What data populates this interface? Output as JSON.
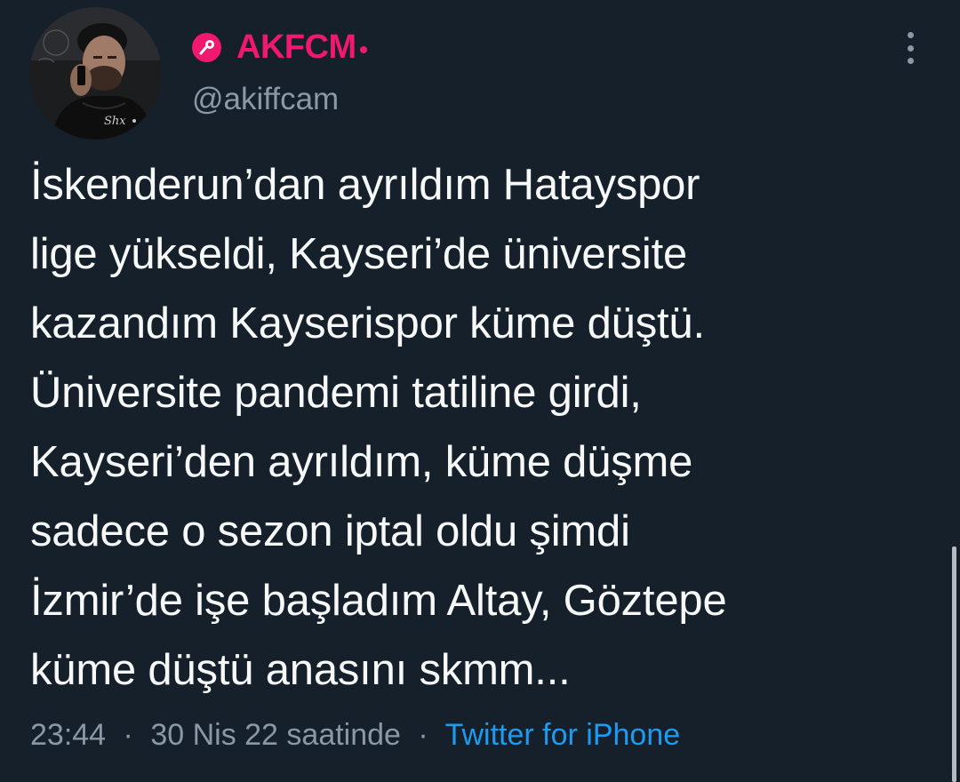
{
  "user": {
    "display_name": "AKFCM",
    "handle": "@akiffcam",
    "avatar_caption": "Shx"
  },
  "tweet": {
    "text": "İskenderun’dan ayrıldım Hatayspor\nlige yükseldi, Kayseri’de üniversite\nkazandım Kayserispor küme düştü.\nÜniversite pandemi tatiline girdi,\nKayseri’den ayrıldım, küme düşme\nsadece o sezon iptal oldu şimdi\nİzmir’de işe başladım Altay, Göztepe\nküme düştü anasını skmm..."
  },
  "meta": {
    "time": "23:44",
    "date_text": "30 Nis 22 saatinde",
    "separator": "·",
    "source": "Twitter for iPhone"
  },
  "icons": {
    "badge": "microphone-icon",
    "menu": "more-vertical-icon"
  },
  "colors": {
    "background": "#15202b",
    "name_accent": "#f0186f",
    "link": "#1d9bf0",
    "muted": "#8b98a5",
    "text": "#f7f9f9"
  }
}
